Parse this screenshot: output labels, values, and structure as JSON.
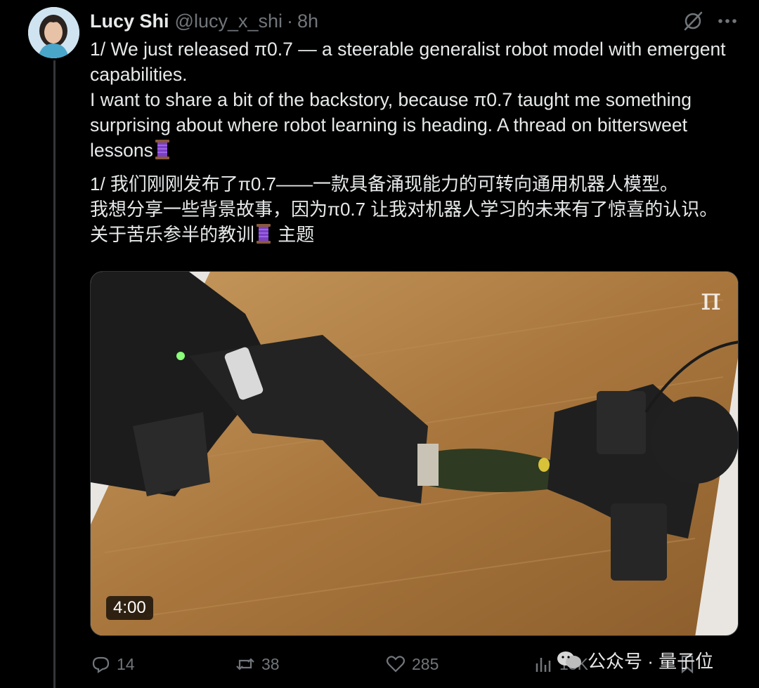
{
  "tweet": {
    "author_name": "Lucy Shi",
    "handle": "@lucy_x_shi",
    "separator": "·",
    "time": "8h",
    "text_en": "1/ We just released π0.7 — a steerable generalist robot model with emergent capabilities.\nI want to share a bit of the backstory, because π0.7 taught me something surprising about where robot learning is heading. A thread on bittersweet lessons",
    "text_cn_line1": "1/ 我们刚刚发布了π0.7——一款具备涌现能力的可转向通用机器人模型。",
    "text_cn_line2": "我想分享一些背景故事，因为π0.7 让我对机器人学习的未来有了惊喜的认识。",
    "text_cn_line3a": "关于苦乐参半的教训",
    "text_cn_line3b": " 主题",
    "emoji": "spool-of-thread-icon"
  },
  "media": {
    "duration": "4:00",
    "logo": "π"
  },
  "actions": {
    "replies": "14",
    "reposts": "38",
    "likes": "285",
    "views": "18K"
  },
  "watermark": {
    "text": "公众号 · 量子位"
  },
  "colors": {
    "background": "#000000",
    "text": "#e7e9ea",
    "muted": "#71767b",
    "divider": "#333639"
  }
}
